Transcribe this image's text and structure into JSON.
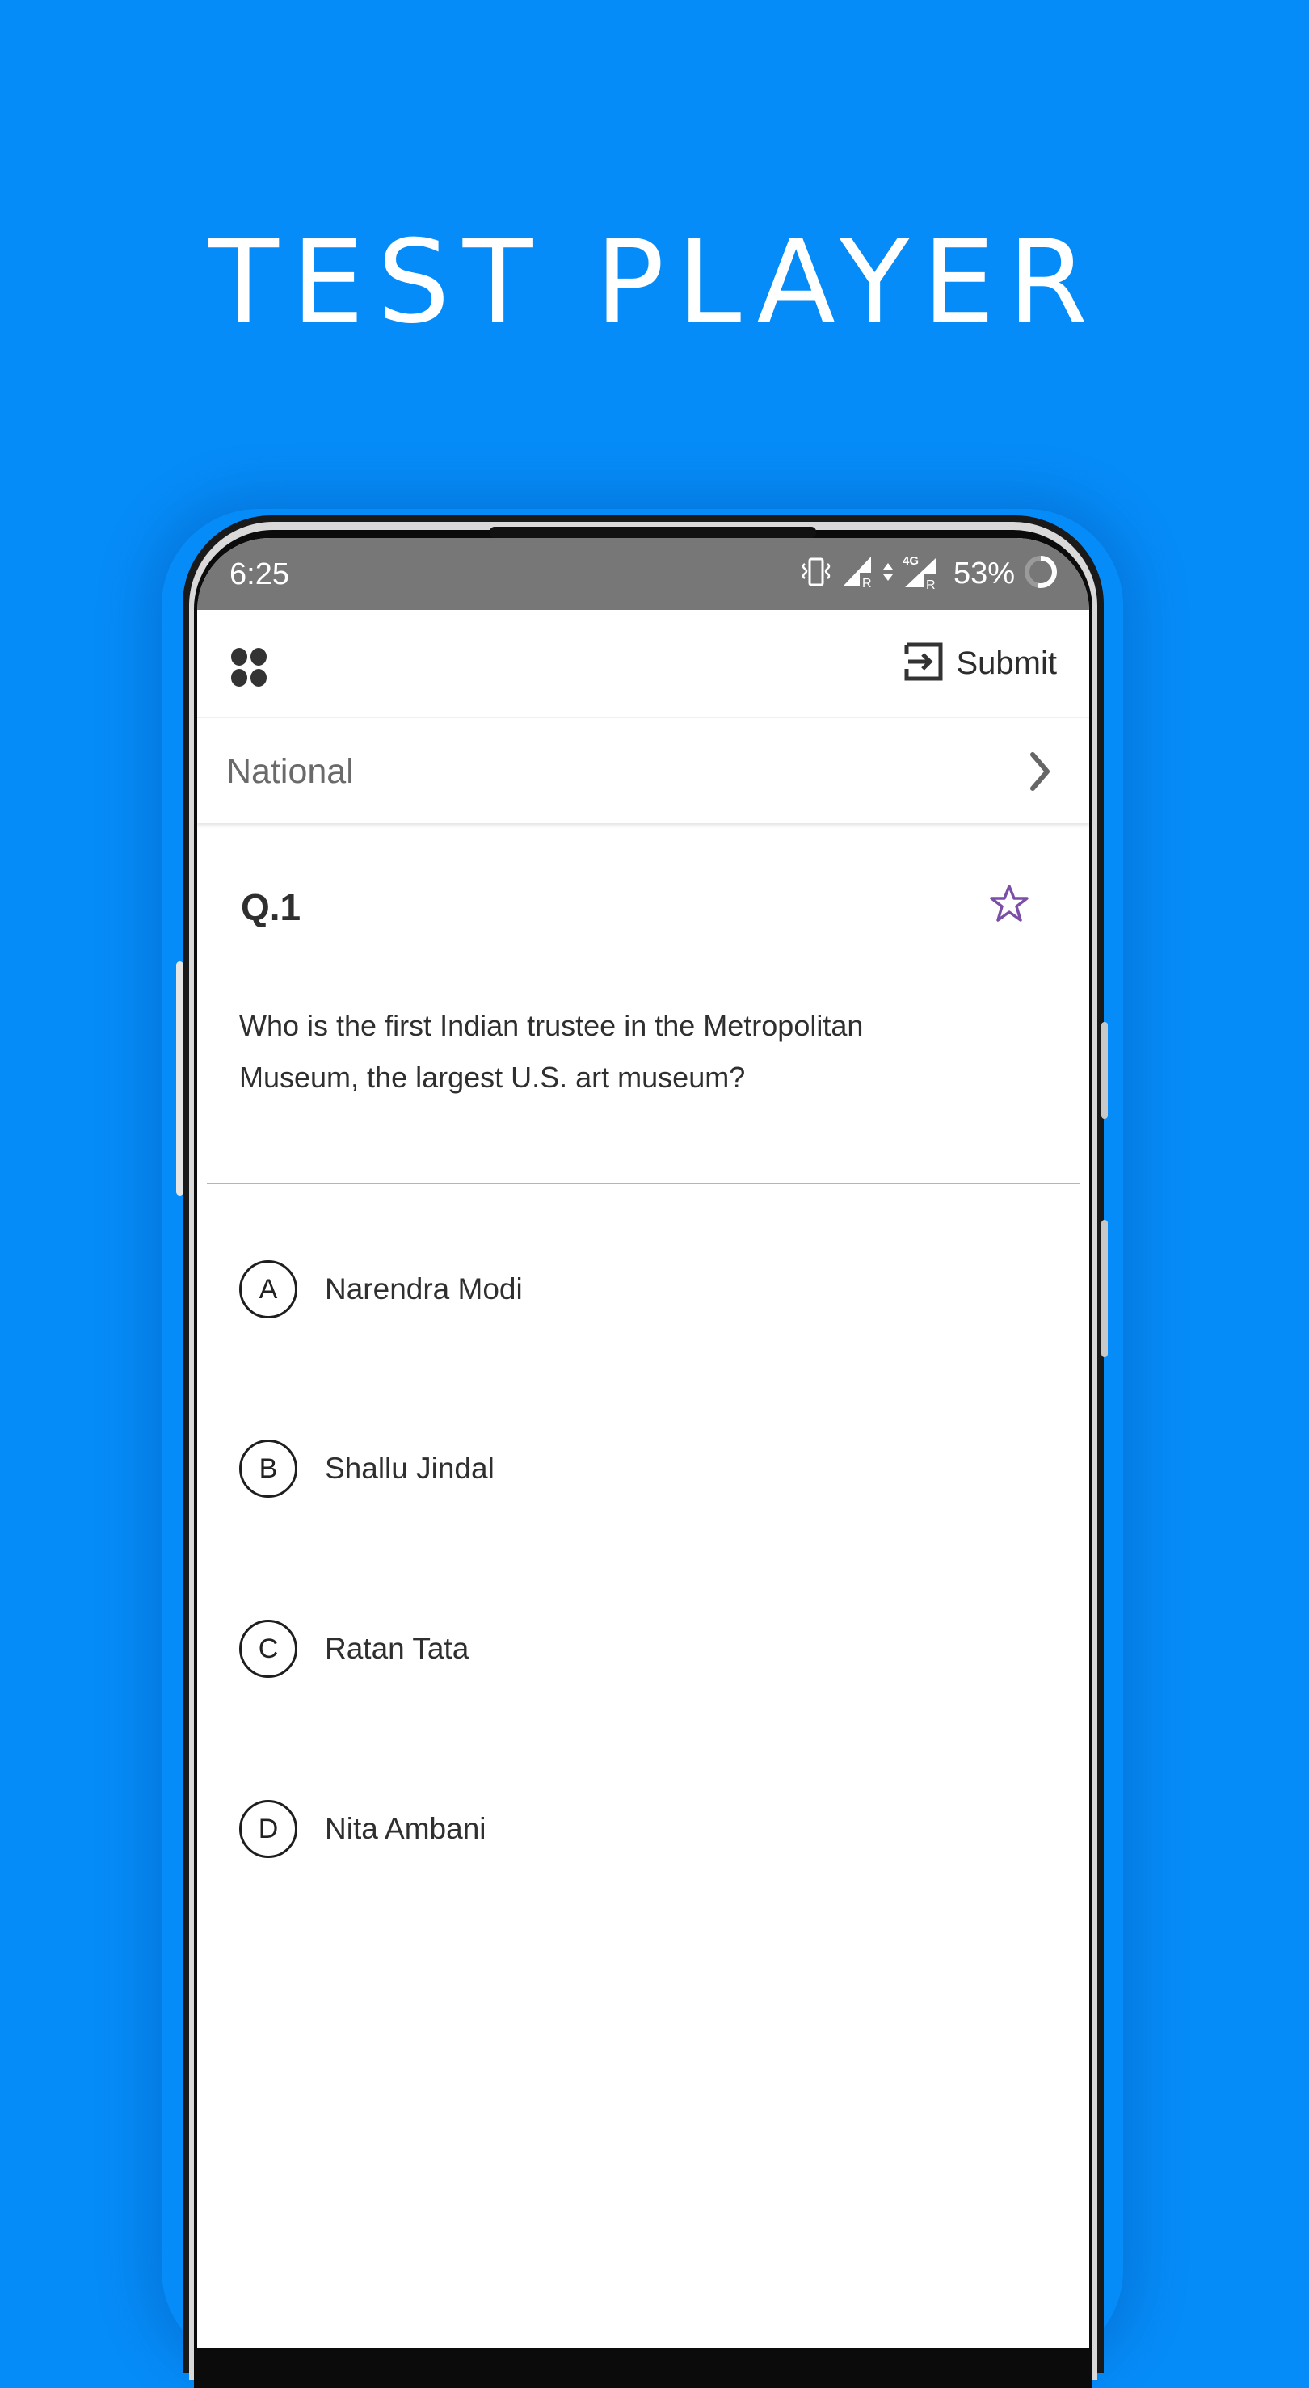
{
  "headline": "TEST PLAYER",
  "colors": {
    "background": "#068cf8",
    "status_bar": "#777777",
    "star_accent": "#7b4ea8",
    "text_dark": "#2f2f2f",
    "text_muted": "#6a6a6a"
  },
  "status_bar": {
    "time": "6:25",
    "icons": [
      "vibrate-icon",
      "signal-roaming-icon",
      "data-arrows-icon",
      "signal-4g-roaming-icon"
    ],
    "network_label": "4G",
    "roaming_label": "R",
    "battery_percent": "53%",
    "battery_level": 0.53
  },
  "app_bar": {
    "menu_icon": "grid-dots-icon",
    "submit_icon": "exit-arrow-icon",
    "submit_label": "Submit"
  },
  "section": {
    "label": "National",
    "chevron_icon": "chevron-right-icon"
  },
  "question": {
    "number": "Q.1",
    "bookmark_icon": "star-outline-icon",
    "text": "Who is the first Indian trustee in the Metropolitan Museum, the largest U.S. art museum?"
  },
  "options": [
    {
      "letter": "A",
      "text": "Narendra Modi"
    },
    {
      "letter": "B",
      "text": "Shallu Jindal"
    },
    {
      "letter": "C",
      "text": "Ratan Tata"
    },
    {
      "letter": "D",
      "text": "Nita Ambani"
    }
  ]
}
